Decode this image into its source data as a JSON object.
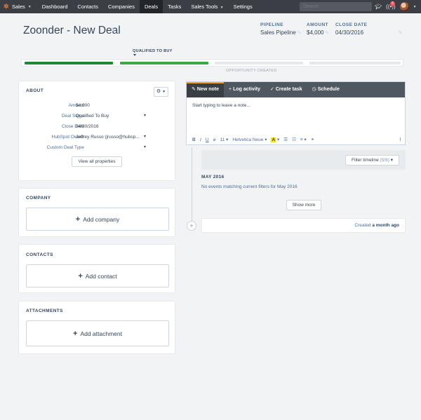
{
  "nav": {
    "brand": "Sales",
    "items": [
      {
        "label": "Dashboard",
        "active": false
      },
      {
        "label": "Contacts",
        "active": false
      },
      {
        "label": "Companies",
        "active": false
      },
      {
        "label": "Deals",
        "active": true
      },
      {
        "label": "Tasks",
        "active": false
      },
      {
        "label": "Sales Tools",
        "active": false,
        "dropdown": true
      },
      {
        "label": "Settings",
        "active": false
      }
    ],
    "search_placeholder": "Search",
    "notification_count": "5"
  },
  "deal": {
    "title": "Zoonder - New Deal",
    "pipeline_label": "PIPELINE",
    "pipeline_value": "Sales Pipeline",
    "amount_label": "AMOUNT",
    "amount_value": "$4,000",
    "close_date_label": "CLOSE DATE",
    "close_date_value": "04/30/2016"
  },
  "stages": {
    "current_label": "QUALIFIED TO BUY",
    "created_label": "OPPORTUNITY CREATED",
    "colors": {
      "complete": "#1f8a32",
      "current": "#3aaa45",
      "pending": "#e5e8eb"
    }
  },
  "about": {
    "heading": "ABOUT",
    "properties": [
      {
        "label": "Amount",
        "value": "$4,000",
        "dropdown": false
      },
      {
        "label": "Deal Stage",
        "value": "Qualified To Buy",
        "dropdown": true
      },
      {
        "label": "Close Date",
        "value": "04/30/2016",
        "dropdown": false
      },
      {
        "label": "HubSpot Owner",
        "value": "Jeffrey Russo (jrusso@hubsp...",
        "dropdown": true
      },
      {
        "label": "Custom Deal Type",
        "value": "",
        "dropdown": true
      }
    ],
    "view_all": "View all properties"
  },
  "company": {
    "heading": "COMPANY",
    "add_label": "Add company"
  },
  "contacts": {
    "heading": "CONTACTS",
    "add_label": "Add contact"
  },
  "attachments": {
    "heading": "ATTACHMENTS",
    "add_label": "Add attachment"
  },
  "editor": {
    "tabs": [
      {
        "label": "New note",
        "icon": "pencil-icon"
      },
      {
        "label": "Log activity",
        "icon": "plus-icon"
      },
      {
        "label": "Create task",
        "icon": "check-icon"
      },
      {
        "label": "Schedule",
        "icon": "clock-icon"
      }
    ],
    "placeholder": "Start typing to leave a note...",
    "font_size": "11",
    "font_name": "Helvetica Neue"
  },
  "timeline": {
    "filter_label": "Filter timeline",
    "filter_count": "(5/8)",
    "month": "MAY 2016",
    "no_events": "No events matching current filters for May 2016",
    "show_more": "Show more",
    "created_prefix": "Created",
    "created_when": "a month ago"
  }
}
